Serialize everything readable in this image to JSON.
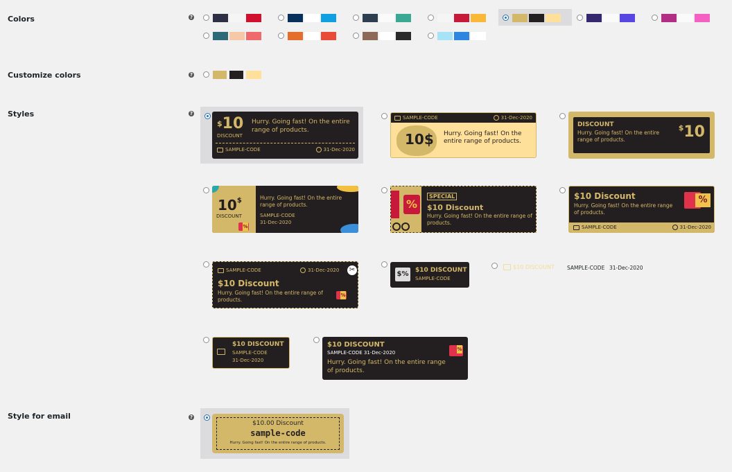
{
  "sections": {
    "colors": "Colors",
    "customize": "Customize colors",
    "styles": "Styles",
    "email": "Style for email"
  },
  "help_glyph": "?",
  "palettes": [
    [
      "#2e2e45",
      "#f5f5f5",
      "#d0102e"
    ],
    [
      "#08305c",
      "#ffffff",
      "#0ea0e0"
    ],
    [
      "#2c3e50",
      "#fafafa",
      "#3aa892"
    ],
    [
      "#f5f5f5",
      "#c7193a",
      "#f9b838"
    ],
    [
      "#d4b86a",
      "#231f20",
      "#ffe09a"
    ],
    [
      "#35286e",
      "#fafafa",
      "#5846e2"
    ],
    [
      "#b22d84",
      "#fafafa",
      "#f561c3"
    ],
    [
      "#2d6a78",
      "#f5c9a8",
      "#ef6b6b"
    ],
    [
      "#e56e2c",
      "#ffffff",
      "#e84c38"
    ],
    [
      "#8c6a57",
      "#ffffff",
      "#2b2b2b"
    ],
    [
      "#a6e3f7",
      "#2f86e0",
      "#ffffff"
    ]
  ],
  "selected_palette_index": 4,
  "custom_colors": [
    "#d4b86a",
    "#231f20",
    "#ffe09a"
  ],
  "coupon": {
    "amount": "10",
    "currency": "$",
    "discount_word": "DISCOUNT",
    "discount_title": "$10 Discount",
    "discount_caps": "$10 DISCOUNT",
    "message": "Hurry. Going fast! On the entire range of products.",
    "code": "SAMPLE-CODE",
    "expiry": "31-Dec-2020",
    "special": "SPECIAL",
    "amount_suffix": "10$"
  },
  "email_coupon": {
    "title": "$10.00 Discount",
    "code": "sample-code",
    "message": "Hurry. Going fast! On the entire range of products."
  }
}
